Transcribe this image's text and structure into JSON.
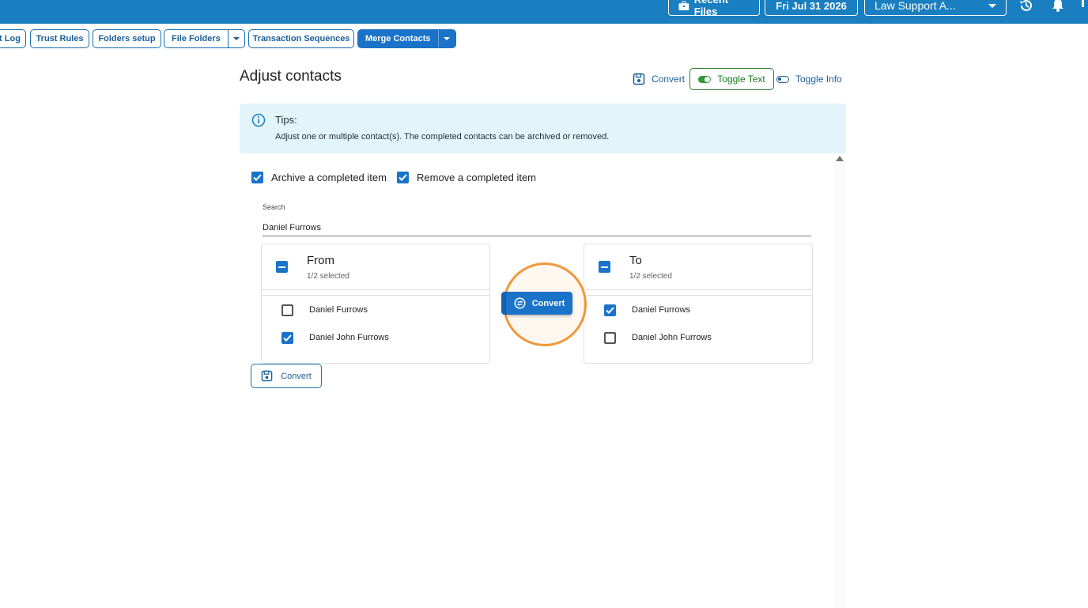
{
  "topbar": {
    "recent_files": "Recent Files",
    "date": "Fri Jul 31 2026",
    "user": "Law Support A...",
    "icons": [
      "history-icon",
      "bell-icon",
      "more-icon"
    ]
  },
  "tabs": [
    {
      "label": "t Log"
    },
    {
      "label": "Trust Rules"
    },
    {
      "label": "Folders setup"
    },
    {
      "label": "File Folders"
    },
    {
      "label": "Transaction Sequences"
    },
    {
      "label": "Merge Contacts"
    }
  ],
  "header": {
    "title": "Adjust contacts",
    "convert": "Convert",
    "toggle_text": "Toggle Text",
    "toggle_info": "Toggle Info"
  },
  "tips": {
    "title": "Tips:",
    "text": "Adjust one or multiple contact(s). The completed contacts can be archived or removed."
  },
  "options": {
    "archive": "Archive a completed item",
    "remove": "Remove a completed item",
    "archive_checked": true,
    "remove_checked": true
  },
  "search": {
    "label": "Search",
    "value": "Daniel Furrows"
  },
  "from_list": {
    "title": "From",
    "selected": "1/2 selected",
    "items": [
      {
        "label": "Daniel Furrows",
        "checked": false
      },
      {
        "label": "Daniel John Furrows",
        "checked": true
      }
    ]
  },
  "to_list": {
    "title": "To",
    "selected": "1/2 selected",
    "items": [
      {
        "label": "Daniel Furrows",
        "checked": true
      },
      {
        "label": "Daniel John Furrows",
        "checked": false
      }
    ]
  },
  "middle": {
    "convert": "Convert"
  },
  "bottom": {
    "convert": "Convert"
  },
  "colors": {
    "brand": "#1a7fc1",
    "primary": "#1a73c9",
    "highlight": "#f0973a",
    "tips_bg": "#e3f4fb",
    "toggle_on": "#2e9b33"
  }
}
